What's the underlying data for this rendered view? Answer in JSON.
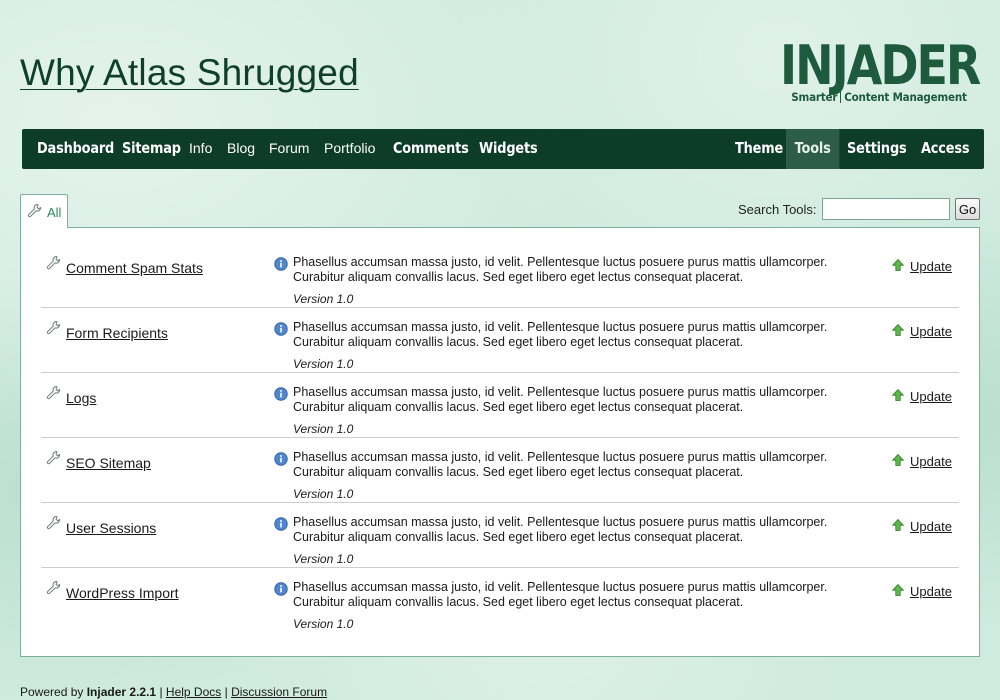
{
  "site": {
    "title": "Why Atlas Shrugged"
  },
  "logo": {
    "word": "INJADER",
    "tagline_left": "Smarter",
    "tagline_right": "Content Management"
  },
  "nav": {
    "left": [
      "Dashboard",
      "Sitemap",
      "Info",
      "Blog",
      "Forum",
      "Portfolio",
      "Comments",
      "Widgets"
    ],
    "right": [
      "Theme",
      "Tools",
      "Settings",
      "Access"
    ],
    "active": "Tools"
  },
  "tabs": [
    {
      "label": "All",
      "icon": "wrench-icon"
    }
  ],
  "search": {
    "label": "Search Tools:",
    "value": "",
    "button": "Go"
  },
  "tools": [
    {
      "name": "Comment Spam Stats",
      "description": "Phasellus accumsan massa justo, id velit. Pellentesque luctus posuere purus mattis ullamcorper. Curabitur aliquam convallis lacus. Sed eget libero eget lectus consequat placerat.",
      "version": "Version 1.0",
      "action": "Update"
    },
    {
      "name": "Form Recipients",
      "description": "Phasellus accumsan massa justo, id velit. Pellentesque luctus posuere purus mattis ullamcorper. Curabitur aliquam convallis lacus. Sed eget libero eget lectus consequat placerat.",
      "version": "Version 1.0",
      "action": "Update"
    },
    {
      "name": "Logs",
      "description": "Phasellus accumsan massa justo, id velit. Pellentesque luctus posuere purus mattis ullamcorper. Curabitur aliquam convallis lacus. Sed eget libero eget lectus consequat placerat.",
      "version": "Version 1.0",
      "action": "Update"
    },
    {
      "name": "SEO Sitemap",
      "description": "Phasellus accumsan massa justo, id velit. Pellentesque luctus posuere purus mattis ullamcorper. Curabitur aliquam convallis lacus. Sed eget libero eget lectus consequat placerat.",
      "version": "Version 1.0",
      "action": "Update"
    },
    {
      "name": "User Sessions",
      "description": "Phasellus accumsan massa justo, id velit. Pellentesque luctus posuere purus mattis ullamcorper. Curabitur aliquam convallis lacus. Sed eget libero eget lectus consequat placerat.",
      "version": "Version 1.0",
      "action": "Update"
    },
    {
      "name": "WordPress Import",
      "description": "Phasellus accumsan massa justo, id velit. Pellentesque luctus posuere purus mattis ullamcorper. Curabitur aliquam convallis lacus. Sed eget libero eget lectus consequat placerat.",
      "version": "Version 1.0",
      "action": "Update"
    }
  ],
  "footer": {
    "powered_by": "Powered by",
    "product": "Injader 2.2.1",
    "separator": "|",
    "help_docs": "Help Docs",
    "forum": "Discussion Forum"
  },
  "colors": {
    "nav_bg": "#0d3d28",
    "nav_active": "#2d5c48",
    "title": "#0f3f2c",
    "tab_text": "#2a8a5e"
  }
}
